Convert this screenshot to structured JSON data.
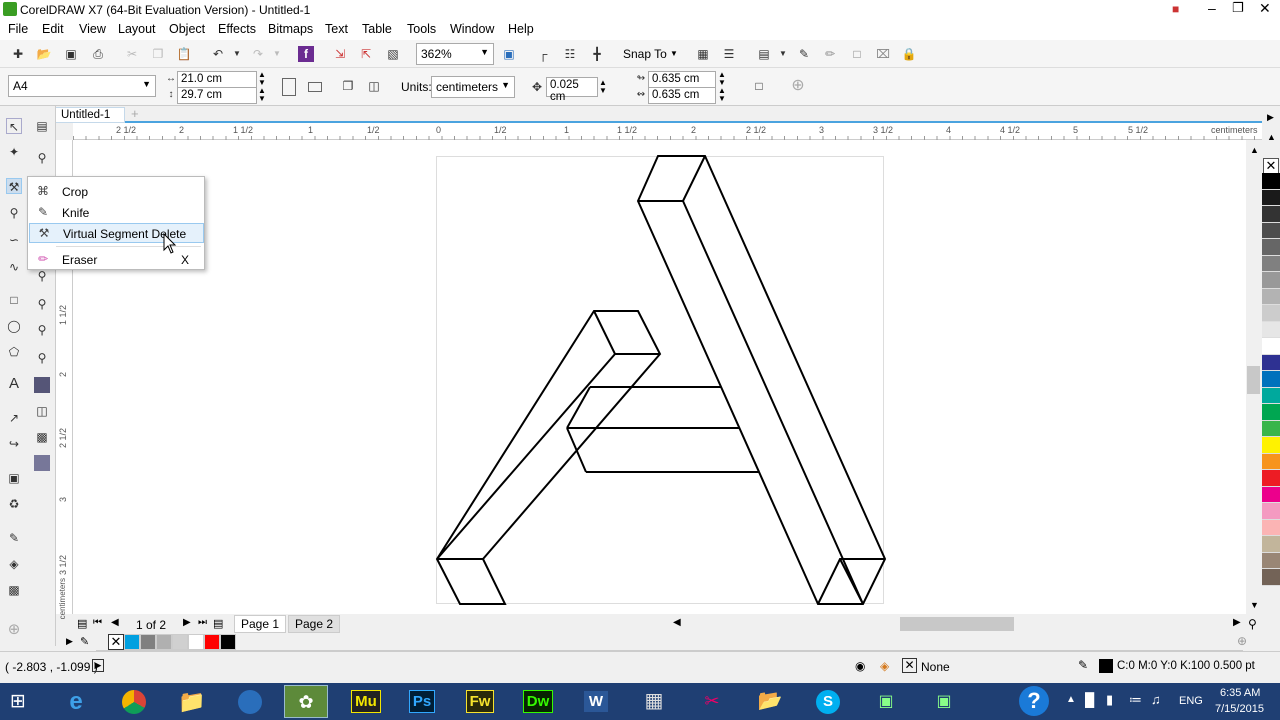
{
  "window": {
    "title": "CorelDRAW X7 (64-Bit Evaluation Version) - Untitled-1",
    "controls": [
      "user-icon",
      "minimize-icon",
      "restore-icon",
      "close-icon"
    ]
  },
  "menubar": [
    "File",
    "Edit",
    "View",
    "Layout",
    "Object",
    "Effects",
    "Bitmaps",
    "Text",
    "Table",
    "Tools",
    "Window",
    "Help"
  ],
  "toolbar": {
    "zoom": "362%",
    "snap_to": "Snap To"
  },
  "propertybar": {
    "page_size": "A4",
    "width": "21.0 cm",
    "height": "29.7 cm",
    "units_label": "Units:",
    "units": "centimeters",
    "nudge": "0.025 cm",
    "dup_x": "0.635 cm",
    "dup_y": "0.635 cm"
  },
  "doc_tab": "Untitled-1",
  "ruler": {
    "h_labels": [
      "2 1/2",
      "2",
      "1 1/2",
      "1",
      "1/2",
      "0",
      "1/2",
      "1",
      "1 1/2",
      "2",
      "2 1/2",
      "3",
      "3 1/2",
      "4",
      "4 1/2",
      "5",
      "5 1/2"
    ],
    "unit": "centimeters",
    "v_labels": [
      "1 1/2",
      "2",
      "2 1/2",
      "3",
      "3 1/2"
    ]
  },
  "flyout": {
    "items": [
      {
        "label": "Crop",
        "icon": "crop-icon",
        "shortcut": ""
      },
      {
        "label": "Knife",
        "icon": "knife-icon",
        "shortcut": ""
      },
      {
        "label": "Virtual Segment Delete",
        "icon": "virtual-segment-delete-icon",
        "shortcut": ""
      },
      {
        "label": "Eraser",
        "icon": "eraser-icon",
        "shortcut": "X"
      }
    ],
    "highlighted": "Virtual Segment Delete"
  },
  "pagenav": {
    "counter": "1 of 2",
    "pages": [
      "Page 1",
      "Page 2"
    ]
  },
  "palette_colors": [
    "#000000",
    "#1a1a1a",
    "#333333",
    "#4d4d4d",
    "#666666",
    "#808080",
    "#999999",
    "#b3b3b3",
    "#cccccc",
    "#e6e6e6",
    "#ffffff",
    "#2e3192",
    "#0071bc",
    "#00a99d",
    "#00a651",
    "#39b54a",
    "#fff200",
    "#f7941d",
    "#ed1c24",
    "#ec008c",
    "#f49ac1",
    "#fbb4b4",
    "#c2b59b",
    "#998675",
    "#736357"
  ],
  "doc_palette_colors": [
    "#00a0e0",
    "#808080",
    "#b0b0b0",
    "#d0d0d0",
    "#ffffff",
    "#ff0000",
    "#000000"
  ],
  "statusbar": {
    "coords": "( -2.803 , -1.099 )",
    "fill": "None",
    "outline": "C:0 M:0 Y:0 K:100  0.500 pt"
  },
  "taskbar": {
    "apps": [
      "Mu",
      "Ps",
      "Fw",
      "Dw"
    ],
    "lang": "ENG",
    "time": "6:35 AM",
    "date": "7/15/2015"
  }
}
